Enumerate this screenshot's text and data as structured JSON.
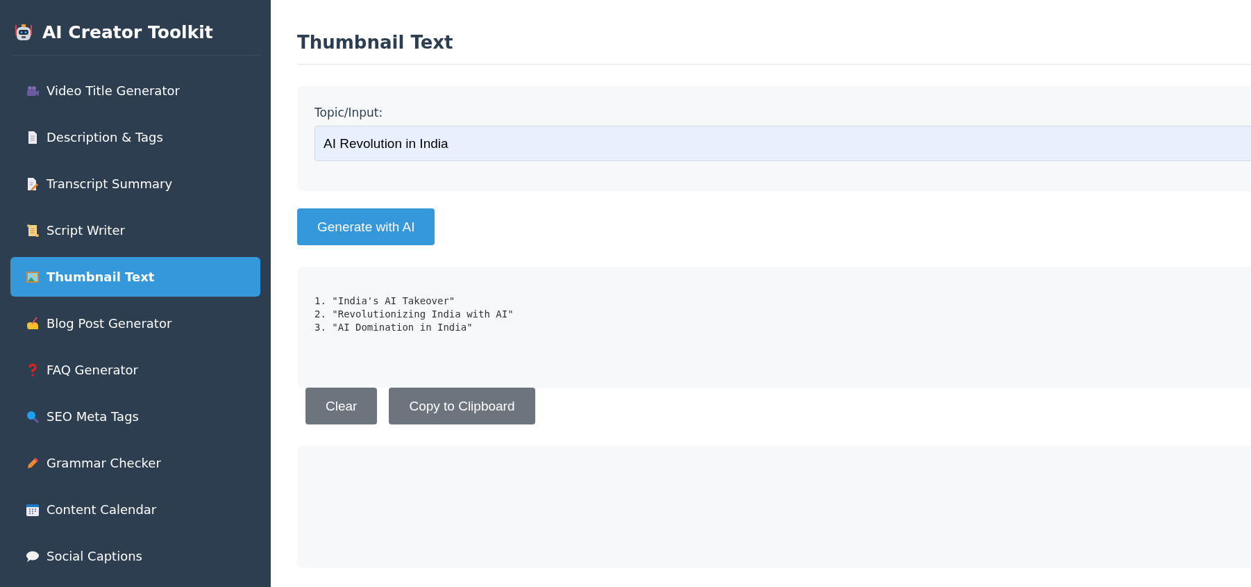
{
  "sidebar": {
    "title": "AI Creator Toolkit",
    "items": [
      {
        "label": "Video Title Generator",
        "selected": false
      },
      {
        "label": "Description & Tags",
        "selected": false
      },
      {
        "label": "Transcript Summary",
        "selected": false
      },
      {
        "label": "Script Writer",
        "selected": false
      },
      {
        "label": "Thumbnail Text",
        "selected": true
      },
      {
        "label": "Blog Post Generator",
        "selected": false
      },
      {
        "label": "FAQ Generator",
        "selected": false
      },
      {
        "label": "SEO Meta Tags",
        "selected": false
      },
      {
        "label": "Grammar Checker",
        "selected": false
      },
      {
        "label": "Content Calendar",
        "selected": false
      },
      {
        "label": "Social Captions",
        "selected": false
      }
    ]
  },
  "main": {
    "heading": "Thumbnail Text",
    "input_label": "Topic/Input:",
    "input_value": "AI Revolution in India",
    "generate_button": "Generate with AI",
    "output": "1. \"India's AI Takeover\"\n2. \"Revolutionizing India with AI\"\n3. \"AI Domination in India\"",
    "buttons": [
      "Clear",
      "Copy to Clipboard"
    ]
  }
}
